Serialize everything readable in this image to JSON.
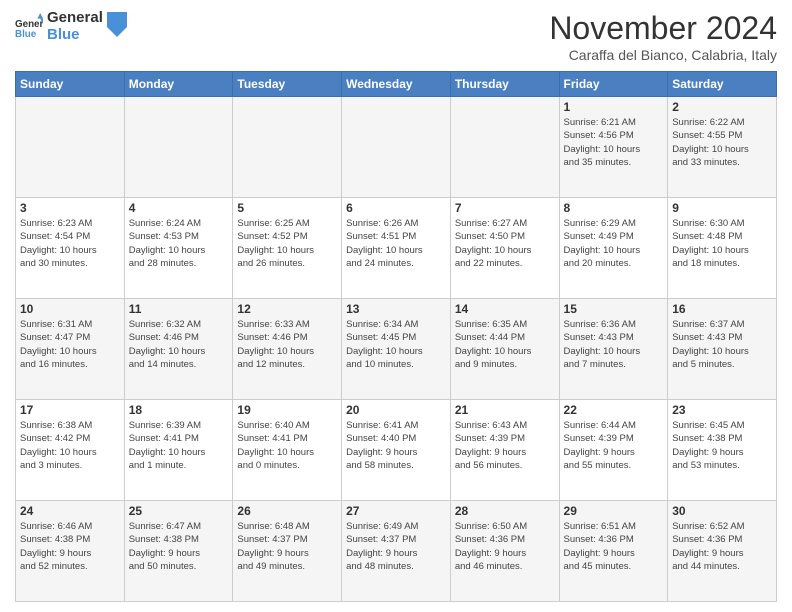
{
  "header": {
    "month_title": "November 2024",
    "location": "Caraffa del Bianco, Calabria, Italy"
  },
  "calendar": {
    "headers": [
      "Sunday",
      "Monday",
      "Tuesday",
      "Wednesday",
      "Thursday",
      "Friday",
      "Saturday"
    ],
    "rows": [
      [
        {
          "day": "",
          "info": ""
        },
        {
          "day": "",
          "info": ""
        },
        {
          "day": "",
          "info": ""
        },
        {
          "day": "",
          "info": ""
        },
        {
          "day": "",
          "info": ""
        },
        {
          "day": "1",
          "info": "Sunrise: 6:21 AM\nSunset: 4:56 PM\nDaylight: 10 hours\nand 35 minutes."
        },
        {
          "day": "2",
          "info": "Sunrise: 6:22 AM\nSunset: 4:55 PM\nDaylight: 10 hours\nand 33 minutes."
        }
      ],
      [
        {
          "day": "3",
          "info": "Sunrise: 6:23 AM\nSunset: 4:54 PM\nDaylight: 10 hours\nand 30 minutes."
        },
        {
          "day": "4",
          "info": "Sunrise: 6:24 AM\nSunset: 4:53 PM\nDaylight: 10 hours\nand 28 minutes."
        },
        {
          "day": "5",
          "info": "Sunrise: 6:25 AM\nSunset: 4:52 PM\nDaylight: 10 hours\nand 26 minutes."
        },
        {
          "day": "6",
          "info": "Sunrise: 6:26 AM\nSunset: 4:51 PM\nDaylight: 10 hours\nand 24 minutes."
        },
        {
          "day": "7",
          "info": "Sunrise: 6:27 AM\nSunset: 4:50 PM\nDaylight: 10 hours\nand 22 minutes."
        },
        {
          "day": "8",
          "info": "Sunrise: 6:29 AM\nSunset: 4:49 PM\nDaylight: 10 hours\nand 20 minutes."
        },
        {
          "day": "9",
          "info": "Sunrise: 6:30 AM\nSunset: 4:48 PM\nDaylight: 10 hours\nand 18 minutes."
        }
      ],
      [
        {
          "day": "10",
          "info": "Sunrise: 6:31 AM\nSunset: 4:47 PM\nDaylight: 10 hours\nand 16 minutes."
        },
        {
          "day": "11",
          "info": "Sunrise: 6:32 AM\nSunset: 4:46 PM\nDaylight: 10 hours\nand 14 minutes."
        },
        {
          "day": "12",
          "info": "Sunrise: 6:33 AM\nSunset: 4:46 PM\nDaylight: 10 hours\nand 12 minutes."
        },
        {
          "day": "13",
          "info": "Sunrise: 6:34 AM\nSunset: 4:45 PM\nDaylight: 10 hours\nand 10 minutes."
        },
        {
          "day": "14",
          "info": "Sunrise: 6:35 AM\nSunset: 4:44 PM\nDaylight: 10 hours\nand 9 minutes."
        },
        {
          "day": "15",
          "info": "Sunrise: 6:36 AM\nSunset: 4:43 PM\nDaylight: 10 hours\nand 7 minutes."
        },
        {
          "day": "16",
          "info": "Sunrise: 6:37 AM\nSunset: 4:43 PM\nDaylight: 10 hours\nand 5 minutes."
        }
      ],
      [
        {
          "day": "17",
          "info": "Sunrise: 6:38 AM\nSunset: 4:42 PM\nDaylight: 10 hours\nand 3 minutes."
        },
        {
          "day": "18",
          "info": "Sunrise: 6:39 AM\nSunset: 4:41 PM\nDaylight: 10 hours\nand 1 minute."
        },
        {
          "day": "19",
          "info": "Sunrise: 6:40 AM\nSunset: 4:41 PM\nDaylight: 10 hours\nand 0 minutes."
        },
        {
          "day": "20",
          "info": "Sunrise: 6:41 AM\nSunset: 4:40 PM\nDaylight: 9 hours\nand 58 minutes."
        },
        {
          "day": "21",
          "info": "Sunrise: 6:43 AM\nSunset: 4:39 PM\nDaylight: 9 hours\nand 56 minutes."
        },
        {
          "day": "22",
          "info": "Sunrise: 6:44 AM\nSunset: 4:39 PM\nDaylight: 9 hours\nand 55 minutes."
        },
        {
          "day": "23",
          "info": "Sunrise: 6:45 AM\nSunset: 4:38 PM\nDaylight: 9 hours\nand 53 minutes."
        }
      ],
      [
        {
          "day": "24",
          "info": "Sunrise: 6:46 AM\nSunset: 4:38 PM\nDaylight: 9 hours\nand 52 minutes."
        },
        {
          "day": "25",
          "info": "Sunrise: 6:47 AM\nSunset: 4:38 PM\nDaylight: 9 hours\nand 50 minutes."
        },
        {
          "day": "26",
          "info": "Sunrise: 6:48 AM\nSunset: 4:37 PM\nDaylight: 9 hours\nand 49 minutes."
        },
        {
          "day": "27",
          "info": "Sunrise: 6:49 AM\nSunset: 4:37 PM\nDaylight: 9 hours\nand 48 minutes."
        },
        {
          "day": "28",
          "info": "Sunrise: 6:50 AM\nSunset: 4:36 PM\nDaylight: 9 hours\nand 46 minutes."
        },
        {
          "day": "29",
          "info": "Sunrise: 6:51 AM\nSunset: 4:36 PM\nDaylight: 9 hours\nand 45 minutes."
        },
        {
          "day": "30",
          "info": "Sunrise: 6:52 AM\nSunset: 4:36 PM\nDaylight: 9 hours\nand 44 minutes."
        }
      ]
    ]
  }
}
